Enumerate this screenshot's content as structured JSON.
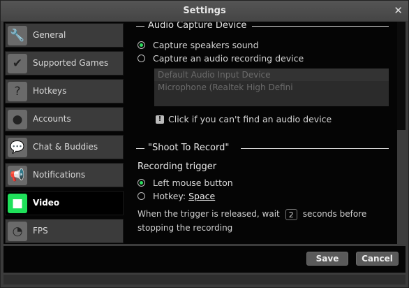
{
  "window": {
    "title": "Settings",
    "close_glyph": "✕"
  },
  "sidebar": {
    "items": [
      {
        "label": "General",
        "icon": "wrench-icon",
        "glyph": "🔧"
      },
      {
        "label": "Supported Games",
        "icon": "checkmark-icon",
        "glyph": "✔"
      },
      {
        "label": "Hotkeys",
        "icon": "hotkey-question-icon",
        "glyph": "?"
      },
      {
        "label": "Accounts",
        "icon": "user-icon",
        "glyph": "●"
      },
      {
        "label": "Chat & Buddies",
        "icon": "chat-bubbles-icon",
        "glyph": "💬"
      },
      {
        "label": "Notifications",
        "icon": "megaphone-icon",
        "glyph": "📢"
      },
      {
        "label": "Video",
        "icon": "video-camera-icon",
        "glyph": "■"
      },
      {
        "label": "FPS",
        "icon": "fps-gauge-icon",
        "glyph": "◔"
      }
    ],
    "active_index": 6
  },
  "audio_capture": {
    "section_title": "Audio Capture Device",
    "option_speakers": "Capture speakers sound",
    "option_device": "Capture an audio recording device",
    "selected": "speakers",
    "devices": [
      "Default Audio Input Device",
      "Microphone (Realtek High Defini"
    ],
    "help_text": "Click if you can't find an audio device",
    "help_glyph": "!"
  },
  "shoot_to_record": {
    "section_title": "\"Shoot To Record\"",
    "trigger_label": "Recording trigger",
    "option_mouse": "Left mouse button",
    "option_hotkey_prefix": "Hotkey:",
    "hotkey_value": "Space",
    "selected": "mouse",
    "wait_prefix": "When the trigger is released, wait",
    "wait_seconds": "2",
    "wait_suffix": "seconds before stopping the recording"
  },
  "footer": {
    "save_label": "Save",
    "cancel_label": "Cancel"
  },
  "colors": {
    "accent_green": "#2ddc5e",
    "active_icon_bg": "#1fe05a",
    "panel_bg": "#050505"
  }
}
